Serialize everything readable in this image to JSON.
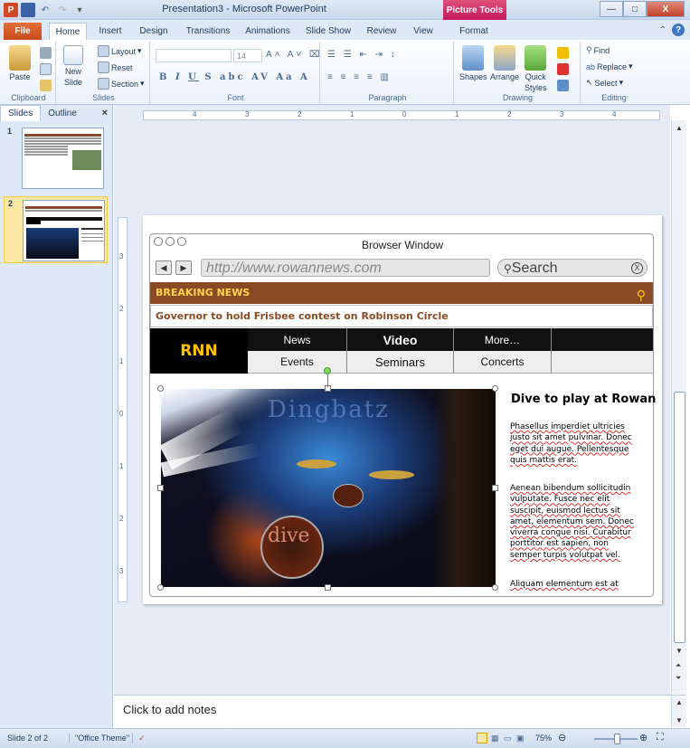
{
  "window": {
    "title": "Presentation3 - Microsoft PowerPoint",
    "context_tab": "Picture Tools",
    "controls": {
      "minimize": "—",
      "maximize": "□",
      "close": "X"
    }
  },
  "tabs": [
    "File",
    "Home",
    "Insert",
    "Design",
    "Transitions",
    "Animations",
    "Slide Show",
    "Review",
    "View",
    "Format"
  ],
  "active_tab": "Home",
  "ribbon": {
    "clipboard": {
      "paste": "Paste",
      "label": "Clipboard"
    },
    "slides": {
      "new_slide_line1": "New",
      "new_slide_line2": "Slide",
      "layout": "Layout",
      "reset": "Reset",
      "section": "Section",
      "label": "Slides"
    },
    "font": {
      "size": "14",
      "label": "Font"
    },
    "paragraph": {
      "label": "Paragraph"
    },
    "drawing": {
      "shapes": "Shapes",
      "arrange": "Arrange",
      "quick_styles_line1": "Quick",
      "quick_styles_line2": "Styles",
      "label": "Drawing"
    },
    "editing": {
      "find": "Find",
      "replace": "Replace",
      "select": "Select",
      "label": "Editing"
    }
  },
  "left_pane": {
    "tabs": [
      "Slides",
      "Outline"
    ],
    "close": "×",
    "slides": [
      {
        "number": "1"
      },
      {
        "number": "2"
      }
    ]
  },
  "ruler": {
    "horizontal": [
      "4",
      "3",
      "2",
      "1",
      "0",
      "1",
      "2",
      "3",
      "4"
    ],
    "vertical": [
      "3",
      "2",
      "1",
      "0",
      "1",
      "2",
      "3"
    ]
  },
  "slide": {
    "browser_title": "Browser Window",
    "url": "http://www.rowannews.com",
    "search_placeholder": "Search",
    "search_clear": "X",
    "breaking": "BREAKING NEWS",
    "headline": "Governor to hold Frisbee contest on Robinson Circle",
    "logo": "RNN",
    "nav_top": [
      "News",
      "Video",
      "More…",
      ""
    ],
    "nav_bottom": [
      "Events",
      "Seminars",
      "Concerts",
      ""
    ],
    "picture_words": [
      "Dingbatz",
      "dive"
    ],
    "article_title": "Dive to play at Rowan",
    "article_p1": "Phasellus imperdiet ultricies justo sit amet pulvinar. Donec eget dui augue. Pellentesque quis mattis erat.",
    "article_p2": "Aenean bibendum sollicitudin vulputate. Fusce nec elit suscipit, euismod lectus sit amet, elementum sem. Donec viverra congue nisi. Curabitur porttitor est sapien, non semper turpis volutpat vel.",
    "article_p3": "Aliquam elementum est at"
  },
  "notes": {
    "placeholder": "Click to add notes"
  },
  "status": {
    "slide": "Slide 2 of 2",
    "theme": "\"Office Theme\"",
    "zoom": "75%"
  }
}
